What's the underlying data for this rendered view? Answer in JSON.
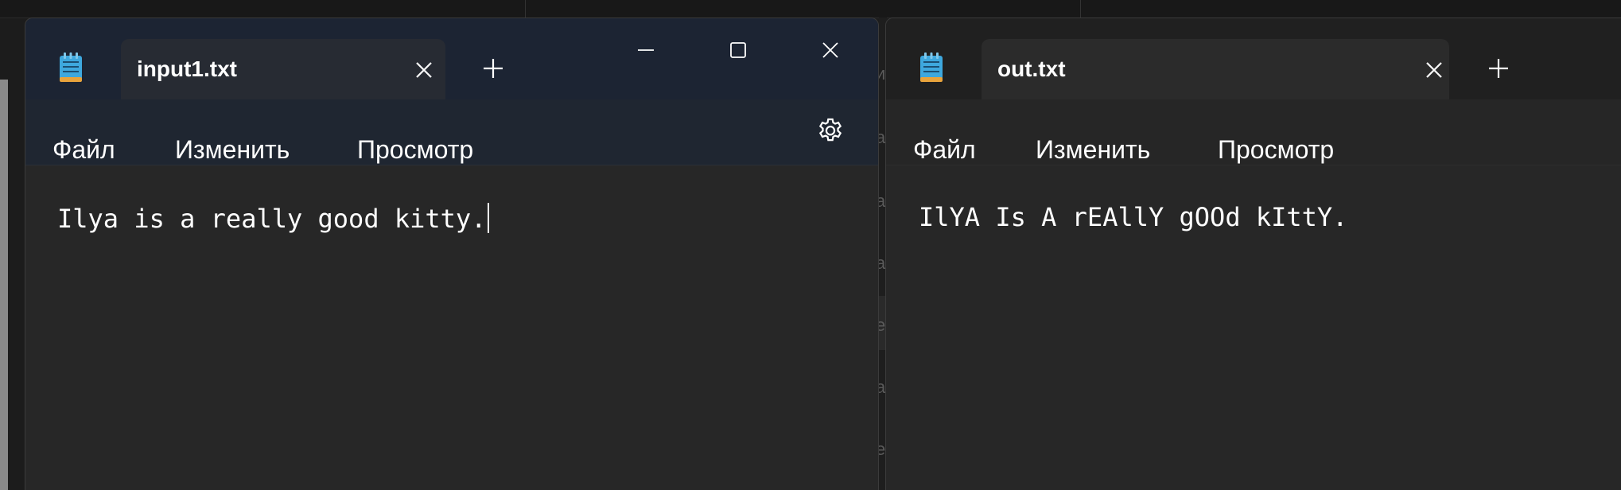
{
  "windows": [
    {
      "id": "left",
      "tab_title": "input1.txt",
      "menu": {
        "file": "Файл",
        "edit": "Изменить",
        "view": "Просмотр"
      },
      "content": "Ilya is a really good kitty.",
      "caption_buttons": [
        "minimize-icon",
        "maximize-icon",
        "close-icon"
      ]
    },
    {
      "id": "right",
      "tab_title": "out.txt",
      "menu": {
        "file": "Файл",
        "edit": "Изменить",
        "view": "Просмотр"
      },
      "content": "IlYA Is A rEAllY gOOd kIttY."
    }
  ],
  "background": {
    "gap_chars": [
      "и",
      "a",
      "a",
      "a",
      "e",
      "a",
      "e"
    ]
  },
  "colors": {
    "titlebar_left": "#1c2433",
    "menubar_left": "#1f2631",
    "editor_bg": "#272727",
    "text": "#ffffff"
  }
}
